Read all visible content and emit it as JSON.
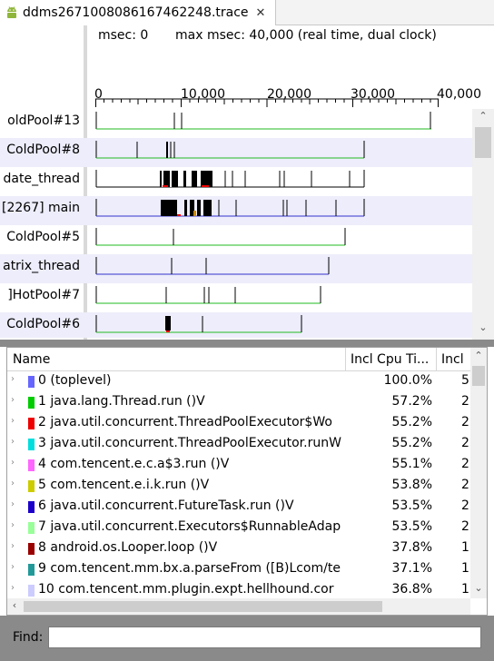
{
  "tab": {
    "title": "ddms2671008086167462248.trace",
    "close_glyph": "✕",
    "icon": "android-icon"
  },
  "header": {
    "msec": "msec: 0",
    "max_msec": "max msec: 40,000 (real time, dual clock)",
    "ticks": [
      "0",
      "10,000",
      "20,000",
      "30,000",
      "40,000"
    ]
  },
  "threads": [
    {
      "label": "oldPool#13"
    },
    {
      "label": "ColdPool#8"
    },
    {
      "label": "date_thread"
    },
    {
      "label": "[2267] main"
    },
    {
      "label": "ColdPool#5"
    },
    {
      "label": "atrix_thread"
    },
    {
      "label": "]HotPool#7"
    },
    {
      "label": "ColdPool#6"
    }
  ],
  "table": {
    "columns": [
      "Name",
      "Incl Cpu Ti...",
      "Incl"
    ],
    "rows": [
      {
        "name": "0 (toplevel)",
        "pct": "100.0%",
        "incl": "5",
        "color": "#6666ff"
      },
      {
        "name": "1 java.lang.Thread.run ()V",
        "pct": "57.2%",
        "incl": "2",
        "color": "#00cc00"
      },
      {
        "name": "2 java.util.concurrent.ThreadPoolExecutor$Wo",
        "pct": "55.2%",
        "incl": "2",
        "color": "#ee0000"
      },
      {
        "name": "3 java.util.concurrent.ThreadPoolExecutor.runW",
        "pct": "55.2%",
        "incl": "2",
        "color": "#00dddd"
      },
      {
        "name": "4 com.tencent.e.c.a$3.run ()V",
        "pct": "55.1%",
        "incl": "2",
        "color": "#ff66ff"
      },
      {
        "name": "5 com.tencent.e.i.k.run ()V",
        "pct": "53.8%",
        "incl": "2",
        "color": "#cccc00"
      },
      {
        "name": "6 java.util.concurrent.FutureTask.run ()V",
        "pct": "53.5%",
        "incl": "2",
        "color": "#1a00c8"
      },
      {
        "name": "7 java.util.concurrent.Executors$RunnableAdap",
        "pct": "53.5%",
        "incl": "2",
        "color": "#99ff99"
      },
      {
        "name": "8 android.os.Looper.loop ()V",
        "pct": "37.8%",
        "incl": "1",
        "color": "#990000"
      },
      {
        "name": "9 com.tencent.mm.bx.a.parseFrom ([B)Lcom/te",
        "pct": "37.1%",
        "incl": "1",
        "color": "#229999"
      },
      {
        "name": "10 com.tencent.mm.plugin.expt.hellhound.cor",
        "pct": "36.8%",
        "incl": "1",
        "color": "#ccccff"
      }
    ]
  },
  "find": {
    "label": "Find:",
    "value": ""
  }
}
